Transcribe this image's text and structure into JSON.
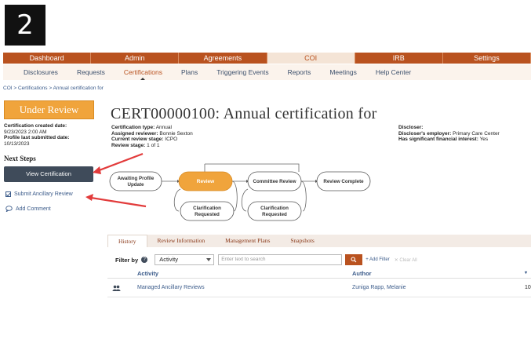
{
  "step_number": "2",
  "nav": {
    "top_tabs": [
      {
        "label": "Dashboard",
        "active": false
      },
      {
        "label": "Admin",
        "active": false
      },
      {
        "label": "Agreements",
        "active": false
      },
      {
        "label": "COI",
        "active": true
      },
      {
        "label": "IRB",
        "active": false
      },
      {
        "label": "Settings",
        "active": false
      }
    ],
    "sub_items": [
      {
        "label": "Disclosures"
      },
      {
        "label": "Requests"
      },
      {
        "label": "Certifications",
        "active": true
      },
      {
        "label": "Plans"
      },
      {
        "label": "Triggering Events"
      },
      {
        "label": "Reports"
      },
      {
        "label": "Meetings"
      },
      {
        "label": "Help Center"
      }
    ]
  },
  "breadcrumb": "COI > Certifications > Annual certification for",
  "status": "Under Review",
  "left_meta": {
    "created_label": "Certification created date:",
    "created_value": "9/23/2023 2:00 AM",
    "submitted_label": "Profile last submitted date:",
    "submitted_value": "10/13/2023"
  },
  "next_steps": {
    "heading": "Next Steps",
    "view_button": "View Certification",
    "ancillary_link": "Submit Ancillary Review",
    "comment_link": "Add Comment"
  },
  "title": "CERT00000100: Annual certification for",
  "mid_meta": {
    "type_label": "Certification type:",
    "type_value": "Annual",
    "reviewer_label": "Assigned reviewer:",
    "reviewer_value": "Bonnie Sexton",
    "stage_label": "Current review stage:",
    "stage_value": "ICPO",
    "review_stage_label": "Review stage:",
    "review_stage_value": "1 of 1"
  },
  "right_meta": {
    "discloser_label": "Discloser:",
    "discloser_value": "",
    "employer_label": "Discloser's employer:",
    "employer_value": "Primary Care Center",
    "interest_label": "Has significant financial interest:",
    "interest_value": "Yes"
  },
  "workflow": {
    "n1": "Awaiting Profile",
    "n1b": "Update",
    "n2": "Review",
    "n3": "Committee Review",
    "n4": "Review Complete",
    "n5": "Clarification",
    "n5b": "Requested",
    "n6": "Clarification",
    "n6b": "Requested",
    "active_color": "#f0a43c"
  },
  "tabs": [
    {
      "label": "History",
      "active": true
    },
    {
      "label": "Review Information"
    },
    {
      "label": "Management Plans"
    },
    {
      "label": "Snapshots"
    }
  ],
  "filter": {
    "label": "Filter by",
    "select_value": "Activity",
    "search_placeholder": "Enter text to search",
    "add_filter": "+ Add Filter",
    "clear_all": "✕ Clear All"
  },
  "grid": {
    "headers": {
      "activity": "Activity",
      "author": "Author"
    },
    "rows": [
      {
        "activity": "Managed Ancillary Reviews",
        "author": "Zuniga Rapp, Melanie",
        "extra": "10"
      }
    ]
  },
  "colors": {
    "brand": "#b9521f",
    "annotation_arrow": "#e23b3b"
  }
}
